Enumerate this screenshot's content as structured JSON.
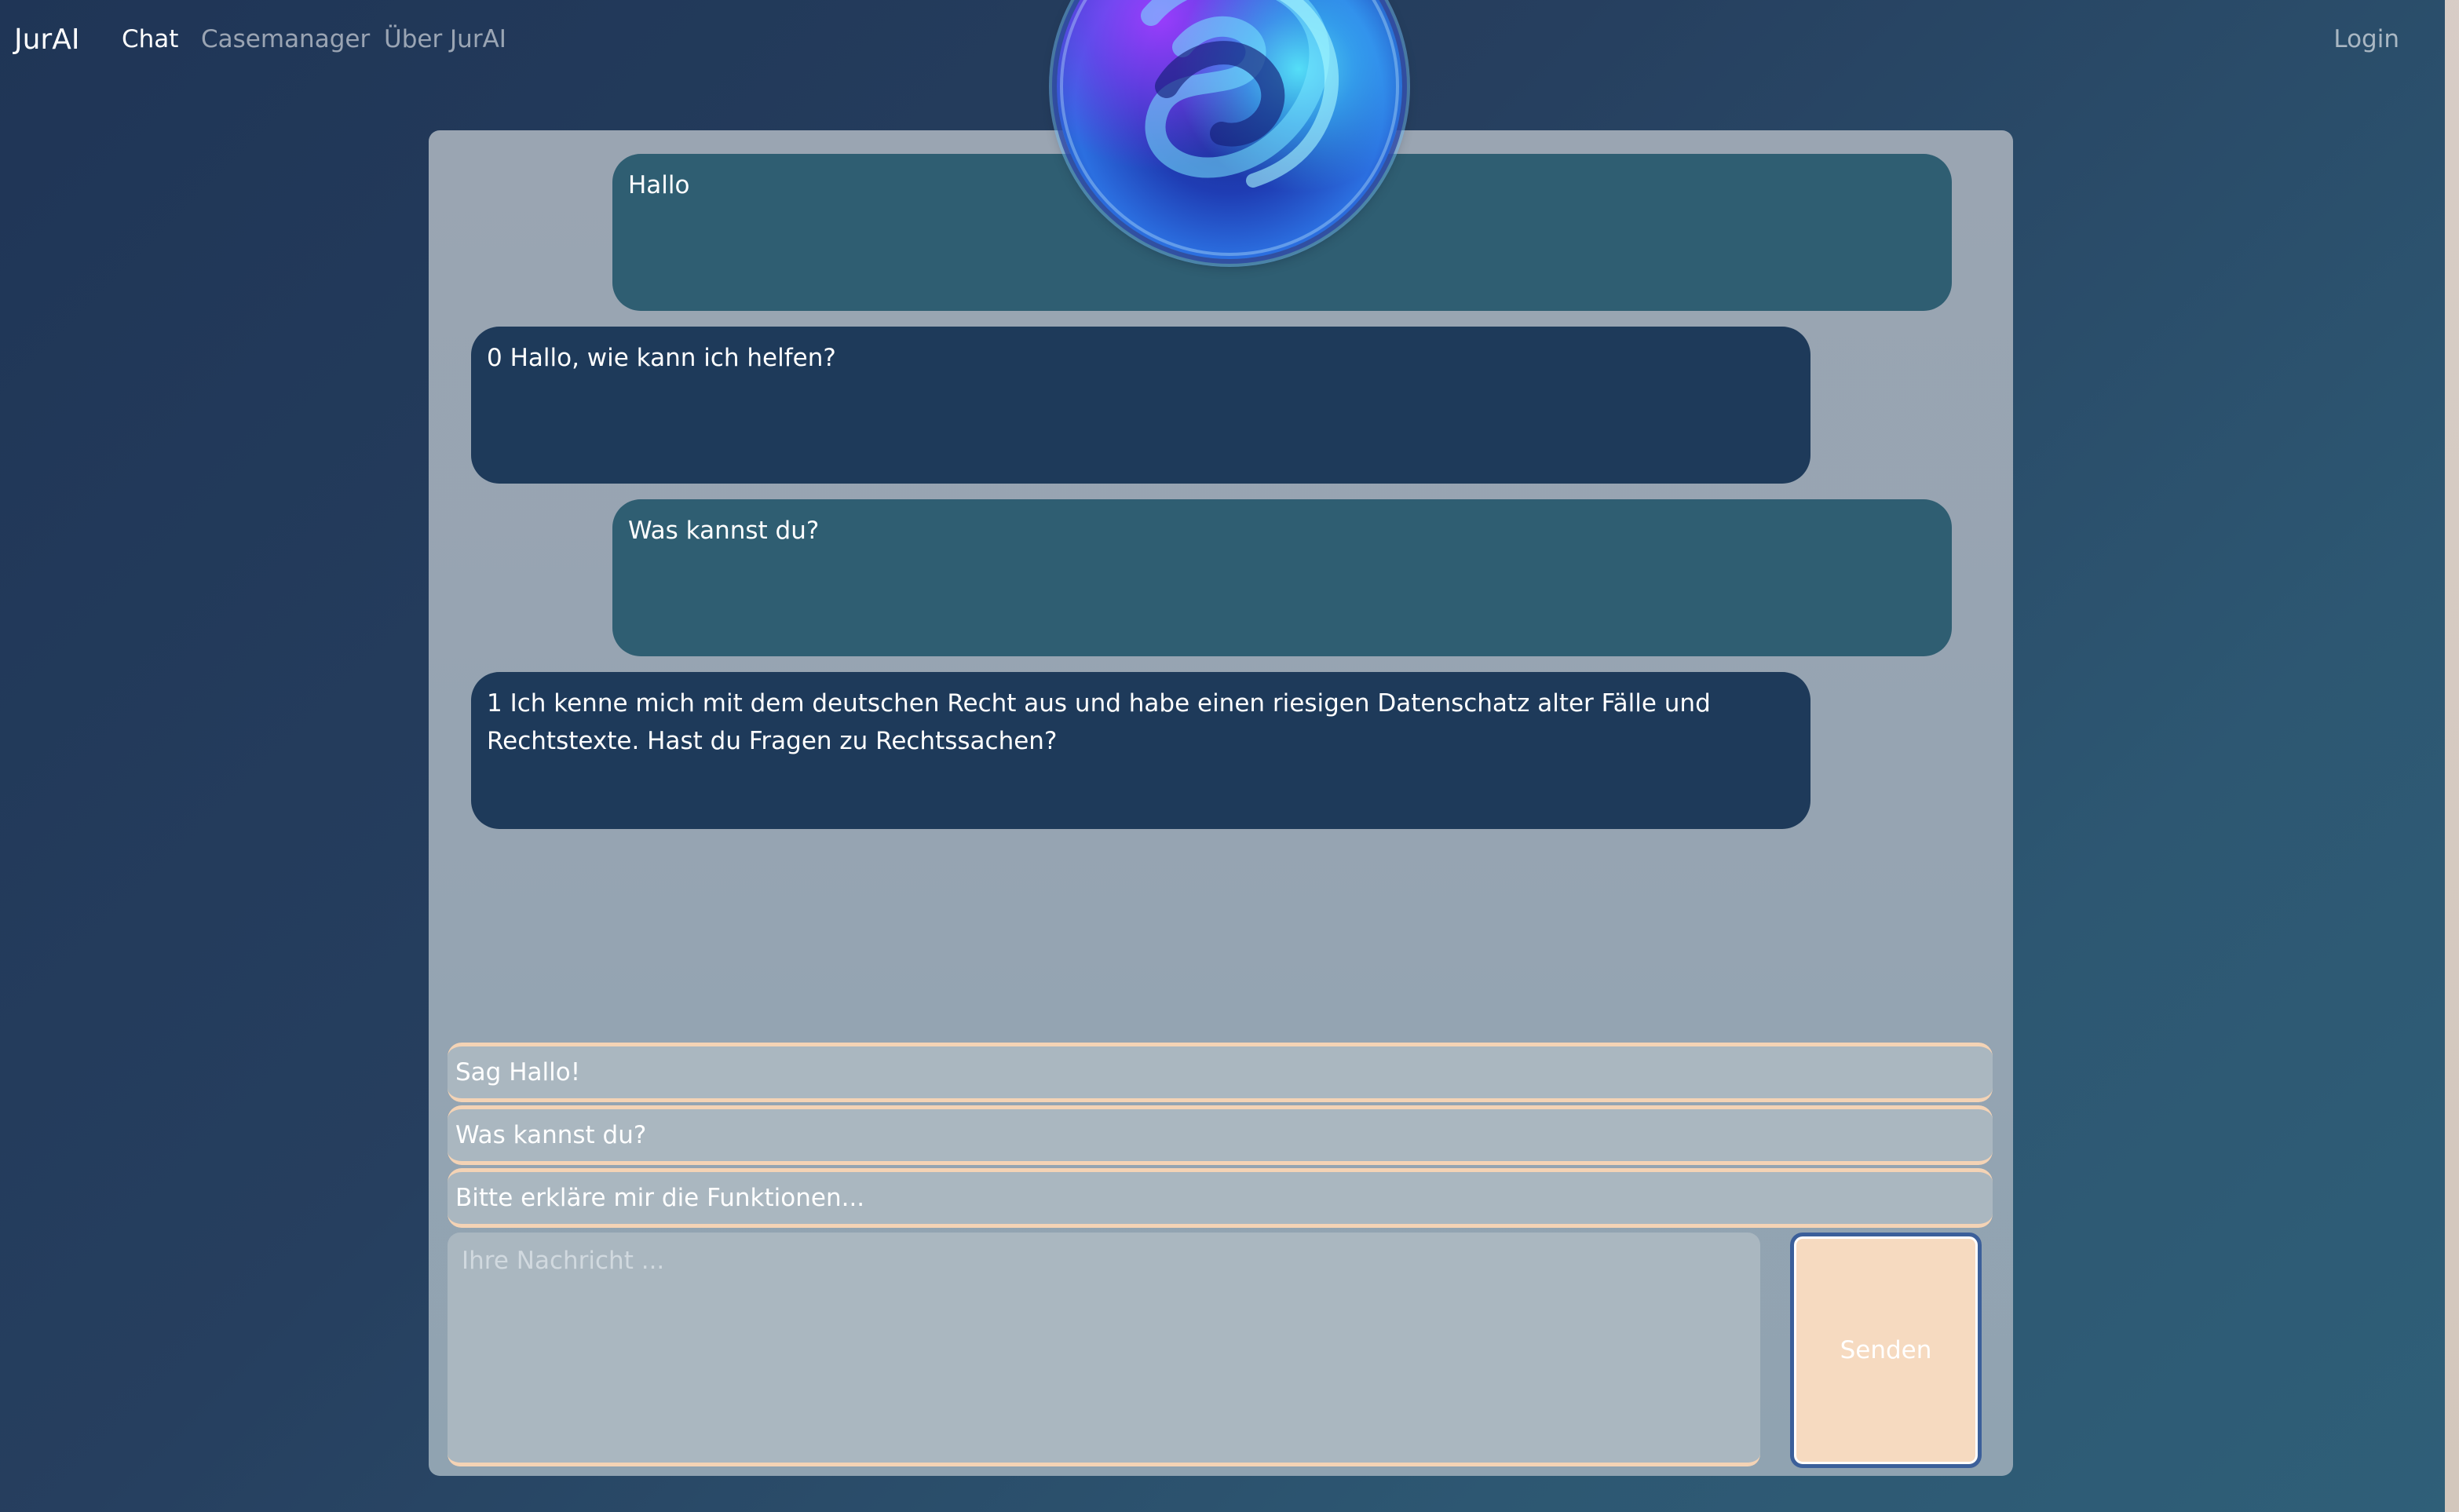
{
  "nav": {
    "brand": "JurAI",
    "links": [
      "Chat",
      "Casemanager",
      "Über JurAI"
    ],
    "login": "Login"
  },
  "messages": [
    {
      "role": "user",
      "text": "Hallo"
    },
    {
      "role": "bot",
      "text": "0 Hallo, wie kann ich helfen?"
    },
    {
      "role": "user",
      "text": "Was kannst du?"
    },
    {
      "role": "bot",
      "text": "1 Ich kenne mich mit dem deutschen Recht aus und habe einen riesigen Datenschatz alter Fälle und Rechtstexte. Hast du Fragen zu Rechtssachen?"
    }
  ],
  "suggestions": [
    "Sag Hallo!",
    "Was kannst du?",
    "Bitte erkläre mir die Funktionen..."
  ],
  "input": {
    "placeholder": "Ihre Nachricht ...",
    "value": ""
  },
  "send_label": "Senden",
  "colors": {
    "user_bubble": "#2f5e72",
    "bot_bubble": "#1e3a5a",
    "accent_peach": "#f6dac0",
    "panel": "#97a5b2"
  },
  "icons": {
    "orb": "assistant-orb-icon"
  }
}
